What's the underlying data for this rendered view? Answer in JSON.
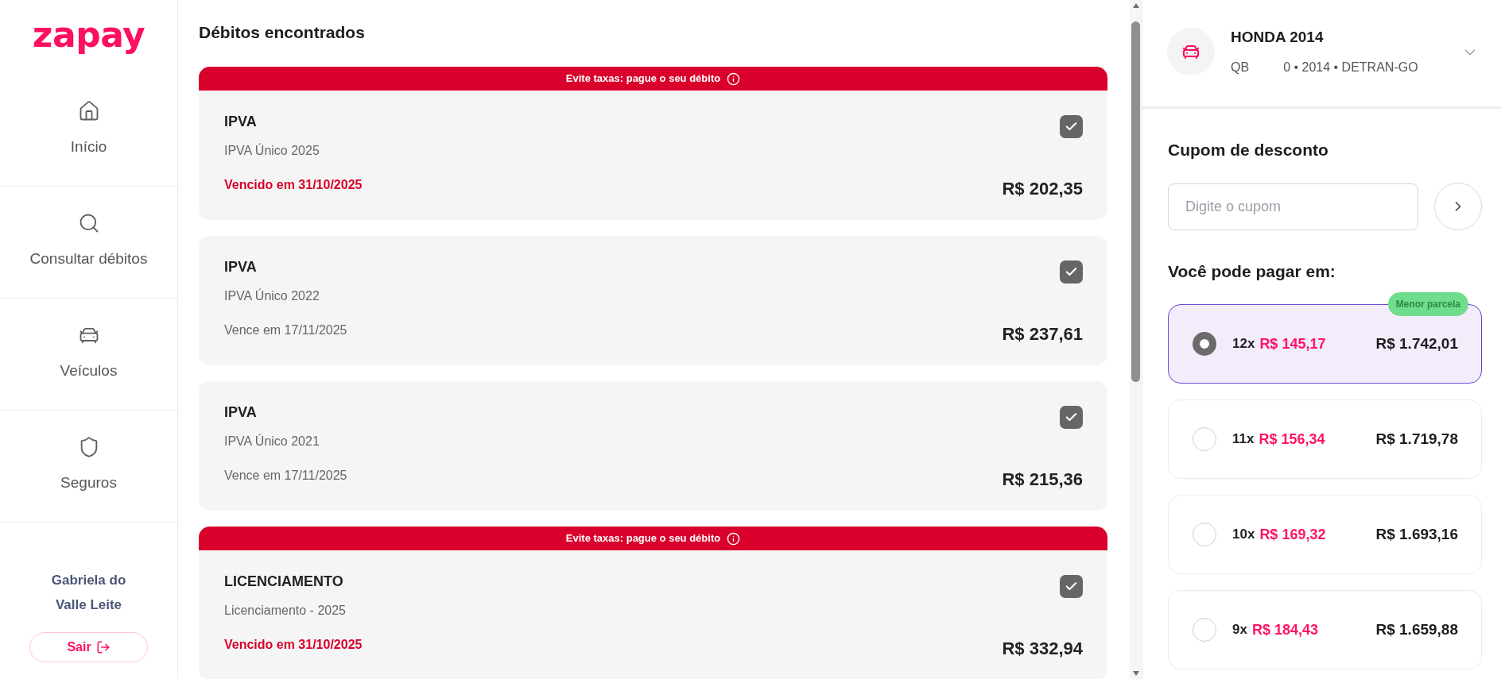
{
  "sidebar": {
    "logo": "zapay",
    "items": [
      {
        "label": "Início"
      },
      {
        "label": "Consultar débitos"
      },
      {
        "label": "Veículos"
      },
      {
        "label": "Seguros"
      }
    ],
    "user_name": "Gabriela do Valle Leite",
    "logout_button": "Sair"
  },
  "debts": {
    "title": "Débitos encontrados",
    "items": [
      {
        "banner": "Evite taxas: pague o seu débito",
        "title": "IPVA",
        "subtitle": "IPVA Único 2025",
        "due": "Vencido em 31/10/2025",
        "overdue": true,
        "amount": "R$ 202,35",
        "checked": true
      },
      {
        "title": "IPVA",
        "subtitle": "IPVA Único 2022",
        "due": "Vence em 17/11/2025",
        "overdue": false,
        "amount": "R$ 237,61",
        "checked": true
      },
      {
        "title": "IPVA",
        "subtitle": "IPVA Único 2021",
        "due": "Vence em 17/11/2025",
        "overdue": false,
        "amount": "R$ 215,36",
        "checked": true
      },
      {
        "banner": "Evite taxas: pague o seu débito",
        "title": "LICENCIAMENTO",
        "subtitle": "Licenciamento - 2025",
        "due": "Vencido em 31/10/2025",
        "overdue": true,
        "amount": "R$ 332,94",
        "checked": true
      }
    ]
  },
  "vehicle": {
    "name": "HONDA 2014",
    "plate_start": "QB",
    "details": "0 • 2014 • DETRAN-GO"
  },
  "coupon": {
    "title": "Cupom de desconto",
    "placeholder": "Digite o cupom"
  },
  "payment": {
    "title": "Você pode pagar em:",
    "options": [
      {
        "count": "12x",
        "installment": "R$ 145,17",
        "total": "R$ 1.742,01",
        "selected": true,
        "badge": "Menor parcela"
      },
      {
        "count": "11x",
        "installment": "R$ 156,34",
        "total": "R$ 1.719,78",
        "selected": false
      },
      {
        "count": "10x",
        "installment": "R$ 169,32",
        "total": "R$ 1.693,16",
        "selected": false
      },
      {
        "count": "9x",
        "installment": "R$ 184,43",
        "total": "R$ 1.659,88",
        "selected": false
      }
    ]
  }
}
